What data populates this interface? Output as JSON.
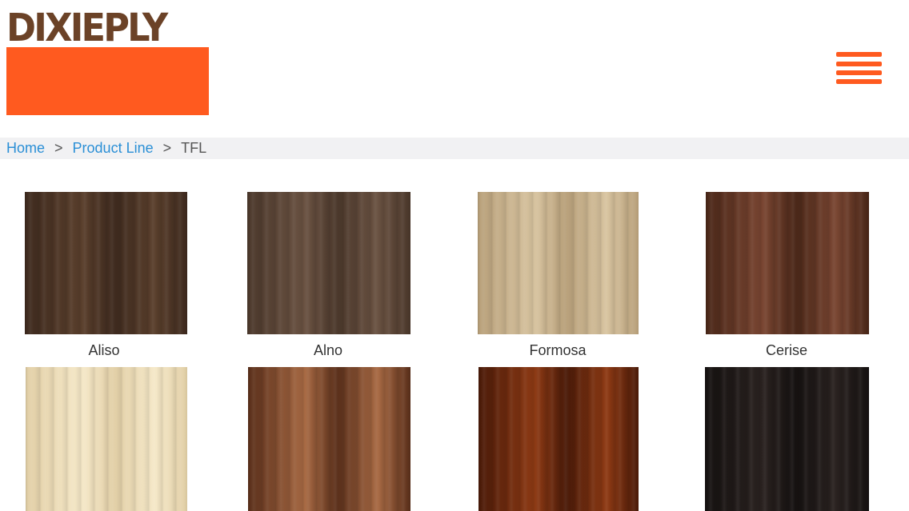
{
  "brand": {
    "logo_text": "DIXIEPLY",
    "text_color": "#6b4227",
    "accent": "#ff5a1f"
  },
  "nav": {
    "menu_icon": "hamburger-menu-icon"
  },
  "breadcrumb": {
    "items": [
      "Home",
      "Product Line",
      "TFL"
    ],
    "separator": ">",
    "link_color": "#2a8fd6",
    "current_color": "#555555",
    "bar_color": "#f1f1f3"
  },
  "products": [
    {
      "name": "Aliso",
      "colors": [
        "#3e2a1e",
        "#5a3f2c"
      ]
    },
    {
      "name": "Alno",
      "colors": [
        "#4b382b",
        "#6a5242"
      ]
    },
    {
      "name": "Formosa",
      "colors": [
        "#b8a07a",
        "#d8c4a0"
      ]
    },
    {
      "name": "Cerise",
      "colors": [
        "#4a2718",
        "#7a4632"
      ]
    },
    {
      "name": "",
      "colors": [
        "#e2cfa6",
        "#f5e8c8"
      ]
    },
    {
      "name": "",
      "colors": [
        "#5a2f1a",
        "#a86a44"
      ]
    },
    {
      "name": "",
      "colors": [
        "#4a1a08",
        "#8e3a14"
      ]
    },
    {
      "name": "",
      "colors": [
        "#151110",
        "#2a2220"
      ]
    }
  ]
}
